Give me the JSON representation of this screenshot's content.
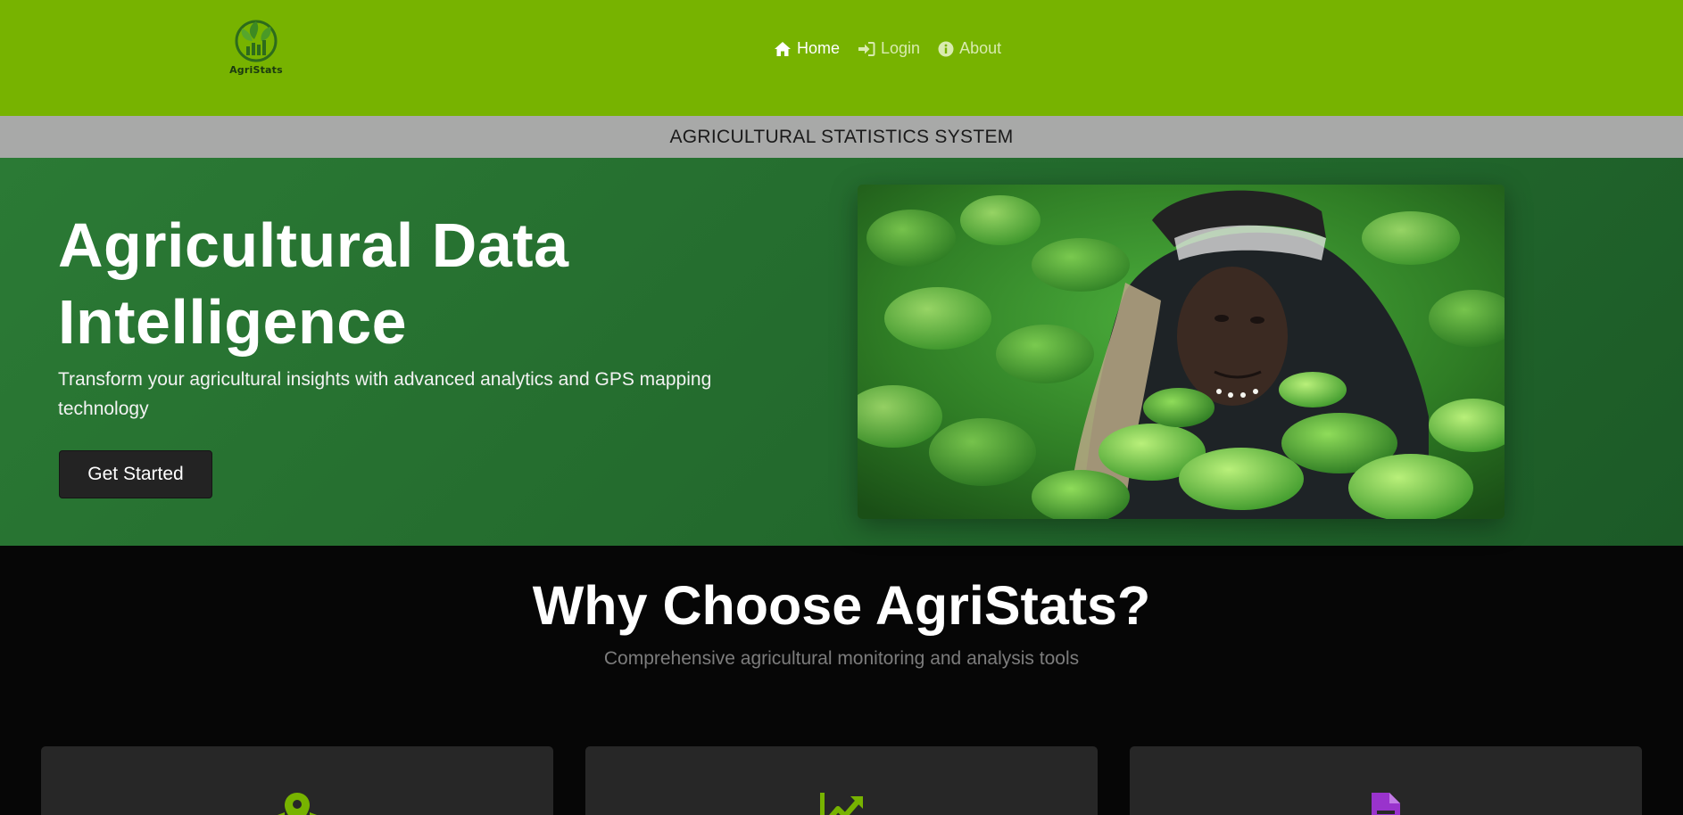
{
  "brand": {
    "name": "AgriStats"
  },
  "nav": {
    "items": [
      {
        "label": "Home",
        "icon": "home-icon",
        "active": true
      },
      {
        "label": "Login",
        "icon": "sign-in-icon",
        "active": false
      },
      {
        "label": "About",
        "icon": "info-icon",
        "active": false
      }
    ]
  },
  "subheader": {
    "title": "AGRICULTURAL STATISTICS SYSTEM"
  },
  "hero": {
    "title": "Agricultural Data Intelligence",
    "subtitle": "Transform your agricultural insights with advanced analytics and GPS mapping technology",
    "cta_label": "Get Started",
    "image": "farmer-in-crop-field-photo"
  },
  "features": {
    "title": "Why Choose AgriStats?",
    "subtitle": "Comprehensive agricultural monitoring and analysis tools",
    "cards": [
      {
        "icon": "map-marker-icon",
        "icon_color": "#77b300"
      },
      {
        "icon": "chart-line-icon",
        "icon_color": "#77b300"
      },
      {
        "icon": "file-icon",
        "icon_color": "#9933cc"
      }
    ]
  },
  "colors": {
    "navbar": "#77b300",
    "hero_bg": "#2b7a35",
    "page_bg": "#060606",
    "card_bg": "#272727"
  }
}
